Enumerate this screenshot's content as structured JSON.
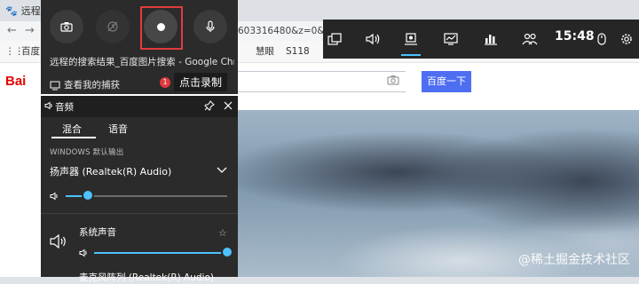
{
  "browser": {
    "tab_title": "远程",
    "url_fragment": "603316480&z=0&",
    "bookmarks": [
      "百度",
      "慧眼",
      "S118"
    ],
    "search_button": "百度一下",
    "logo": "Bai"
  },
  "capture": {
    "window_title": "远程的搜索结果_百度图片搜索 - Google Chr...",
    "show_all_captures": "查看我的捕获",
    "badge_count": "1",
    "tooltip": "点击录制"
  },
  "topbar": {
    "time": "15:48",
    "icons": [
      "widget-menu-icon",
      "audio-icon",
      "capture-icon",
      "performance-icon",
      "resources-icon",
      "social-icon",
      "mouse-icon",
      "settings-icon"
    ]
  },
  "audio": {
    "title": "音频",
    "tabs": [
      "混合",
      "语音"
    ],
    "active_tab": "混合",
    "default_output_label": "WINDOWS 默认输出",
    "output_device": "扬声器 (Realtek(R) Audio)",
    "master_volume": 0.14,
    "apps": [
      {
        "name": "系统声音",
        "volume": 1.0
      },
      {
        "name": "麦克风阵列 (Realtek(R) Audio)"
      }
    ]
  },
  "watermark": "@稀土掘金技术社区",
  "colors": {
    "accent": "#4cc2ff",
    "record_highlight": "#e03c3c",
    "panel": "#2b2b2b"
  }
}
